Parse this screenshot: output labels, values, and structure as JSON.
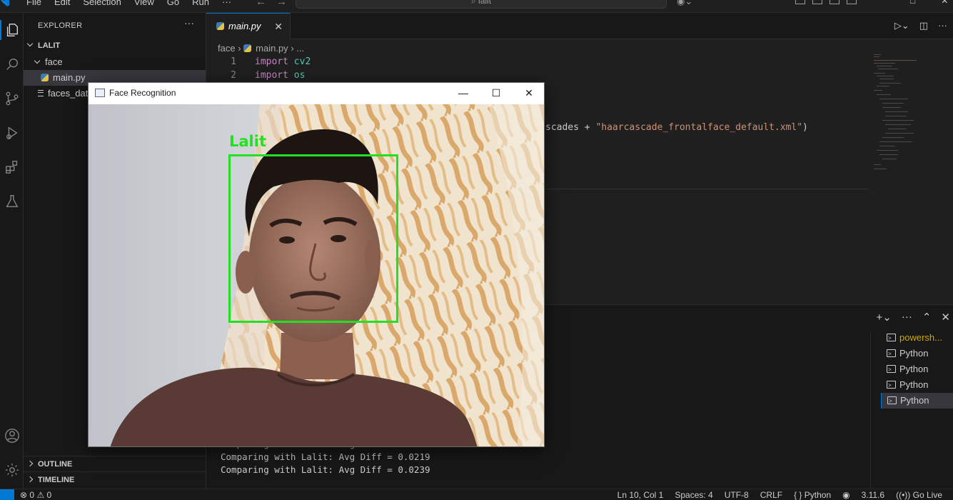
{
  "menu": [
    "File",
    "Edit",
    "Selection",
    "View",
    "Go",
    "Run",
    "···"
  ],
  "search": {
    "text": "lalit"
  },
  "explorer": {
    "title": "EXPLORER",
    "more": "···",
    "root": "LALIT",
    "folder": "face",
    "file_selected": "main.py",
    "file_other": "faces_data"
  },
  "outline": "OUTLINE",
  "timeline": "TIMELINE",
  "tab": {
    "label": "main.py",
    "close": "✕"
  },
  "breadcrumb": {
    "folder": "face",
    "file": "main.py",
    "more": "..."
  },
  "code": {
    "line1_num": "1",
    "line1_kw": "import",
    "line1_mod": "cv2",
    "line2_num": "2",
    "line2_kw": "import",
    "line2_mod": "os",
    "partial_plain": "scades + ",
    "partial_str": "\"haarcascade_frontalface_default.xml\"",
    "partial_close": ")"
  },
  "terminal": {
    "lines": [
      "Comparing with Lalit: Avg Diff = 0.0198",
      "Comparing with Lalit: Avg Diff = 0.0219",
      "Comparing with Lalit: Avg Diff = 0.0239"
    ],
    "list": [
      "powersh...",
      "Python",
      "Python",
      "Python",
      "Python"
    ]
  },
  "status": {
    "errors": "0",
    "warnings": "0",
    "position": "Ln 10, Col 1",
    "spaces": "Spaces: 4",
    "encoding": "UTF-8",
    "eol": "CRLF",
    "language": "Python",
    "version": "3.11.6",
    "golive": "Go Live"
  },
  "face_window": {
    "title": "Face Recognition",
    "label": "Lalit"
  },
  "colors": {
    "accent": "#0078d4",
    "box": "#22e022"
  }
}
